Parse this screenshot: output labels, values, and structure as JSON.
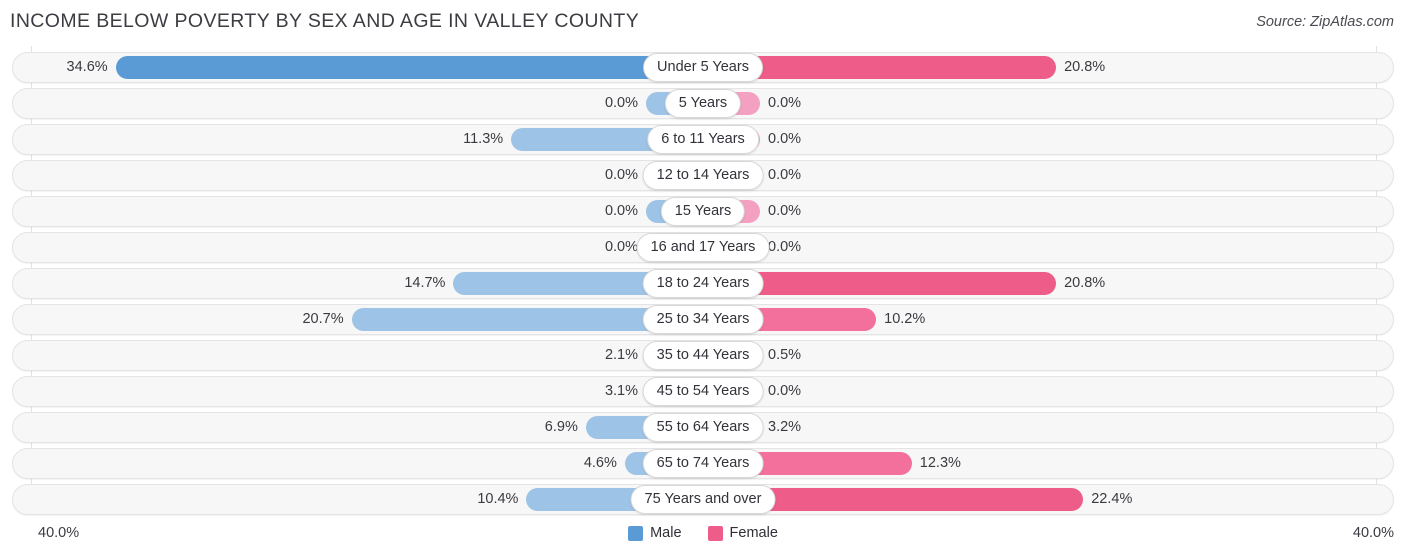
{
  "header": {
    "title": "INCOME BELOW POVERTY BY SEX AND AGE IN VALLEY COUNTY",
    "source": "Source: ZipAtlas.com"
  },
  "legend": {
    "male_label": "Male",
    "female_label": "Female",
    "male_color": "#5b9bd5",
    "female_color": "#ee5d8a"
  },
  "axis": {
    "left_max": "40.0%",
    "right_max": "40.0%",
    "max_value": 40.0
  },
  "chart_data": {
    "type": "bar",
    "orientation": "horizontal-diverging",
    "title": "INCOME BELOW POVERTY BY SEX AND AGE IN VALLEY COUNTY",
    "xlabel": "",
    "ylabel": "",
    "xlim": [
      40.0,
      40.0
    ],
    "grid": true,
    "legend_position": "bottom-center",
    "categories": [
      "Under 5 Years",
      "5 Years",
      "6 to 11 Years",
      "12 to 14 Years",
      "15 Years",
      "16 and 17 Years",
      "18 to 24 Years",
      "25 to 34 Years",
      "35 to 44 Years",
      "45 to 54 Years",
      "55 to 64 Years",
      "65 to 74 Years",
      "75 Years and over"
    ],
    "series": [
      {
        "name": "Male",
        "color": "#5b9bd5",
        "values": [
          34.6,
          0.0,
          11.3,
          0.0,
          0.0,
          0.0,
          14.7,
          20.7,
          2.1,
          3.1,
          6.9,
          4.6,
          10.4
        ],
        "labels": [
          "34.6%",
          "0.0%",
          "11.3%",
          "0.0%",
          "0.0%",
          "0.0%",
          "14.7%",
          "20.7%",
          "2.1%",
          "3.1%",
          "6.9%",
          "4.6%",
          "10.4%"
        ]
      },
      {
        "name": "Female",
        "color": "#ee5d8a",
        "values": [
          20.8,
          0.0,
          0.0,
          0.0,
          0.0,
          0.0,
          20.8,
          10.2,
          0.5,
          0.0,
          3.2,
          12.3,
          22.4
        ],
        "labels": [
          "20.8%",
          "0.0%",
          "0.0%",
          "0.0%",
          "0.0%",
          "0.0%",
          "20.8%",
          "10.2%",
          "0.5%",
          "0.0%",
          "3.2%",
          "12.3%",
          "22.4%"
        ]
      }
    ]
  }
}
